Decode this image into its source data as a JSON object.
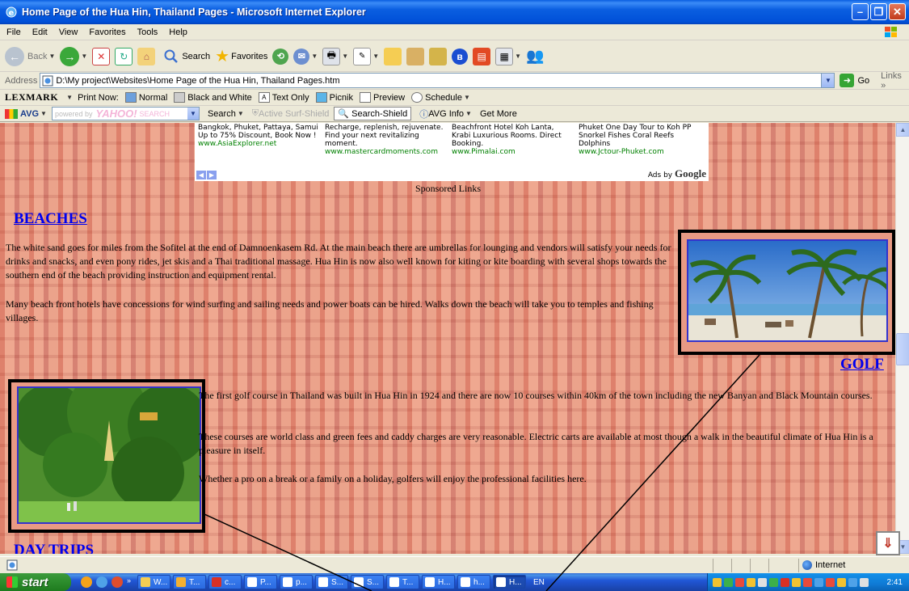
{
  "window": {
    "title": "Home Page of the Hua Hin, Thailand Pages - Microsoft Internet Explorer"
  },
  "menubar": {
    "items": [
      "File",
      "Edit",
      "View",
      "Favorites",
      "Tools",
      "Help"
    ]
  },
  "toolbar": {
    "back_label": "Back",
    "search_label": "Search",
    "favorites_label": "Favorites"
  },
  "address": {
    "label": "Address",
    "value": "D:\\My project\\Websites\\Home Page of the Hua Hin, Thailand Pages.htm",
    "go_label": "Go",
    "links_label": "Links"
  },
  "lexmark": {
    "logo": "LEXMARK",
    "print_now": "Print Now:",
    "normal": "Normal",
    "black_white": "Black and White",
    "text_only": "Text Only",
    "picnik": "Picnik",
    "preview": "Preview",
    "schedule": "Schedule"
  },
  "avg": {
    "logo": "AVG",
    "powered_by": "powered by",
    "yahoo": "YAHOO!",
    "yahoo_search": "SEARCH",
    "search_label": "Search",
    "active_surf_shield": "Active Surf-Shield",
    "search_shield": "Search-Shield",
    "avg_info": "AVG Info",
    "get_more": "Get More"
  },
  "ads": [
    {
      "text": "Bangkok, Phuket, Pattaya, Samui Up to 75% Discount, Book Now !",
      "url": "www.AsiaExplorer.net"
    },
    {
      "text": "Recharge, replenish, rejuvenate. Find your next revitalizing moment.",
      "url": "www.mastercardmoments.com"
    },
    {
      "text": "Beachfront Hotel Koh Lanta, Krabi Luxurious Rooms. Direct Booking.",
      "url": "www.Pimalai.com"
    },
    {
      "text": "Phuket One Day Tour to Koh PP Snorkel Fishes Coral Reefs Dolphins",
      "url": "www.Jctour-Phuket.com"
    }
  ],
  "ads_by": "Ads by",
  "ads_google": "Google",
  "sponsored_links": "Sponsored Links",
  "beaches": {
    "heading": "BEACHES",
    "p1": "The white sand goes for miles from the Sofitel at the end of Damnoenkasem Rd. At the main beach there are umbrellas for lounging and vendors will satisfy your needs for drinks and snacks, and even pony rides, jet skis and a Thai traditional massage. Hua Hin is now also well known for kiting or kite boarding with several shops towards the southern end of the beach providing instruction and equipment rental.",
    "p2": "Many beach front hotels have concessions for wind surfing and sailing needs and power boats can be hired. Walks down the beach will take you to temples and fishing villages."
  },
  "golf": {
    "heading": "GOLF",
    "p1": "The first golf course in Thailand was built in Hua Hin in 1924 and there are now 10 courses within 40km of the town including the new Banyan and Black Mountain courses.",
    "p2": "These courses are world class and green fees and caddy charges are very reasonable. Electric carts are available at most though a walk in the beautiful climate of Hua Hin is a pleasure in itself.",
    "p3": "Whether a pro on a break or a family on a holiday, golfers will enjoy the professional facilities here."
  },
  "day_trips": {
    "heading": "DAY TRIPS"
  },
  "status": {
    "zone": "Internet"
  },
  "taskbar": {
    "start": "start",
    "tasks": [
      "W...",
      "T...",
      "c...",
      "P...",
      "p...",
      "S...",
      "S...",
      "T...",
      "H...",
      "h...",
      "H..."
    ],
    "lang": "EN",
    "clock": "2:41"
  }
}
